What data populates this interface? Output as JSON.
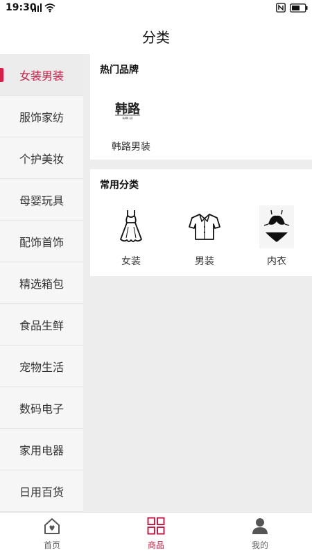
{
  "status_bar": {
    "time": "19:30",
    "signal": "4G",
    "icons": [
      "signal-icon",
      "wifi-icon",
      "nfc-icon",
      "battery-icon"
    ]
  },
  "header": {
    "title": "分类"
  },
  "sidebar": {
    "active_index": 0,
    "items": [
      {
        "label": "女装男装"
      },
      {
        "label": "服饰家纺"
      },
      {
        "label": "个护美妆"
      },
      {
        "label": "母婴玩具"
      },
      {
        "label": "配饰首饰"
      },
      {
        "label": "精选箱包"
      },
      {
        "label": "食品生鲜"
      },
      {
        "label": "宠物生活"
      },
      {
        "label": "数码电子"
      },
      {
        "label": "家用电器"
      },
      {
        "label": "日用百货"
      }
    ]
  },
  "hot_brands": {
    "title": "热门品牌",
    "items": [
      {
        "logo_text": "韩路",
        "logo_sub": "HAN LU",
        "label": "韩路男装"
      }
    ]
  },
  "common_categories": {
    "title": "常用分类",
    "items": [
      {
        "label": "女装",
        "icon": "dress-icon"
      },
      {
        "label": "男装",
        "icon": "shirt-icon"
      },
      {
        "label": "内衣",
        "icon": "bikini-icon"
      }
    ]
  },
  "bottom_nav": {
    "active_index": 1,
    "items": [
      {
        "label": "首页",
        "icon": "home-icon"
      },
      {
        "label": "商品",
        "icon": "grid-icon"
      },
      {
        "label": "我的",
        "icon": "user-icon"
      }
    ]
  },
  "colors": {
    "accent": "#c41d45",
    "sidebar_bg": "#f6f6f6",
    "content_bg": "#ededed"
  }
}
